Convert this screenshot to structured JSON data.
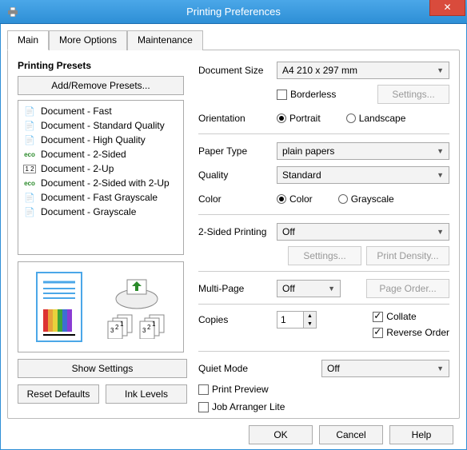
{
  "window": {
    "title": "Printing Preferences",
    "close_icon": "✕"
  },
  "tabs": [
    {
      "label": "Main",
      "selected": true
    },
    {
      "label": "More Options",
      "selected": false
    },
    {
      "label": "Maintenance",
      "selected": false
    }
  ],
  "presets": {
    "header": "Printing Presets",
    "add_remove_label": "Add/Remove Presets...",
    "items": [
      {
        "icon": "doc",
        "label": "Document - Fast"
      },
      {
        "icon": "doc",
        "label": "Document - Standard Quality"
      },
      {
        "icon": "doc",
        "label": "Document - High Quality"
      },
      {
        "icon": "eco",
        "label": "Document - 2-Sided"
      },
      {
        "icon": "2up",
        "label": "Document - 2-Up"
      },
      {
        "icon": "eco",
        "label": "Document - 2-Sided with 2-Up"
      },
      {
        "icon": "gray",
        "label": "Document - Fast Grayscale"
      },
      {
        "icon": "gray",
        "label": "Document - Grayscale"
      }
    ],
    "show_settings_label": "Show Settings",
    "reset_defaults_label": "Reset Defaults",
    "ink_levels_label": "Ink Levels"
  },
  "form": {
    "document_size_label": "Document Size",
    "document_size_value": "A4 210 x 297 mm",
    "borderless_label": "Borderless",
    "borderless_checked": false,
    "borderless_settings_label": "Settings...",
    "orientation_label": "Orientation",
    "orientation_portrait_label": "Portrait",
    "orientation_landscape_label": "Landscape",
    "orientation_value": "Portrait",
    "paper_type_label": "Paper Type",
    "paper_type_value": "plain papers",
    "quality_label": "Quality",
    "quality_value": "Standard",
    "color_label": "Color",
    "color_color_label": "Color",
    "color_grayscale_label": "Grayscale",
    "color_value": "Color",
    "twosided_label": "2-Sided Printing",
    "twosided_value": "Off",
    "twosided_settings_label": "Settings...",
    "print_density_label": "Print Density...",
    "multipage_label": "Multi-Page",
    "multipage_value": "Off",
    "page_order_label": "Page Order...",
    "copies_label": "Copies",
    "copies_value": "1",
    "collate_label": "Collate",
    "collate_checked": true,
    "reverse_order_label": "Reverse Order",
    "reverse_order_checked": true,
    "quiet_mode_label": "Quiet Mode",
    "quiet_mode_value": "Off",
    "print_preview_label": "Print Preview",
    "print_preview_checked": false,
    "job_arranger_label": "Job Arranger Lite",
    "job_arranger_checked": false
  },
  "footer": {
    "ok": "OK",
    "cancel": "Cancel",
    "help": "Help"
  },
  "icons": {
    "doc": "📄",
    "eco": "eco",
    "2up": "1⃣2⃣",
    "gray": "📄"
  }
}
